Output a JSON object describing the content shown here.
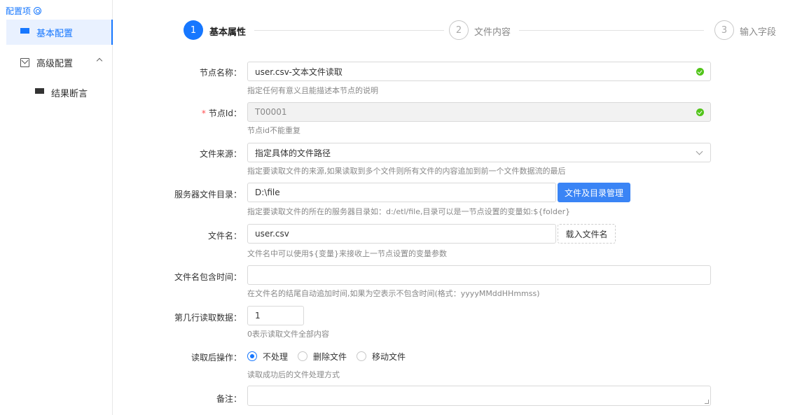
{
  "sidebar": {
    "title": "配置项",
    "items": [
      {
        "label": "基本配置",
        "icon": "grid-icon",
        "active": true
      },
      {
        "label": "高级配置",
        "icon": "cube-icon",
        "expanded": true
      },
      {
        "label": "结果断言",
        "icon": "grid-icon",
        "sub": true
      }
    ]
  },
  "steps": [
    {
      "num": "1",
      "label": "基本属性",
      "status": "active"
    },
    {
      "num": "2",
      "label": "文件内容",
      "status": "wait"
    },
    {
      "num": "3",
      "label": "输入字段",
      "status": "wait"
    }
  ],
  "form": {
    "node_name": {
      "label": "节点名称：",
      "value": "user.csv-文本文件读取",
      "help": "指定任何有意义且能描述本节点的说明"
    },
    "node_id": {
      "label": "节点Id：",
      "required_mark": "*",
      "value": "T00001",
      "help": "节点id不能重复"
    },
    "file_source": {
      "label": "文件来源：",
      "value": "指定具体的文件路径",
      "help": "指定要读取文件的来源,如果读取到多个文件则所有文件的内容追加到前一个文件数据流的最后"
    },
    "server_dir": {
      "label": "服务器文件目录：",
      "value": "D:\\file",
      "button": "文件及目录管理",
      "help": "指定要读取文件的所在的服务器目录如：d:/etl/file,目录可以是一节点设置的变量如:${folder}"
    },
    "file_name": {
      "label": "文件名：",
      "value": "user.csv",
      "button": "载入文件名",
      "help": "文件名中可以使用${变量}来接收上一节点设置的变量参数"
    },
    "file_time": {
      "label": "文件名包含时间：",
      "value": "",
      "help": "在文件名的结尾自动追加时间,如果为空表示不包含时间(格式：yyyyMMddHHmmss)"
    },
    "start_row": {
      "label": "第几行读取数据：",
      "value": "1",
      "help": "0表示读取文件全部内容"
    },
    "after_read": {
      "label": "读取后操作：",
      "options": [
        "不处理",
        "删除文件",
        "移动文件"
      ],
      "selected": "不处理",
      "help": "读取成功后的文件处理方式"
    },
    "remark": {
      "label": "备注：",
      "value": ""
    }
  },
  "colors": {
    "accent": "#1677ff",
    "success": "#52c41a",
    "required": "#ff4d4f"
  }
}
